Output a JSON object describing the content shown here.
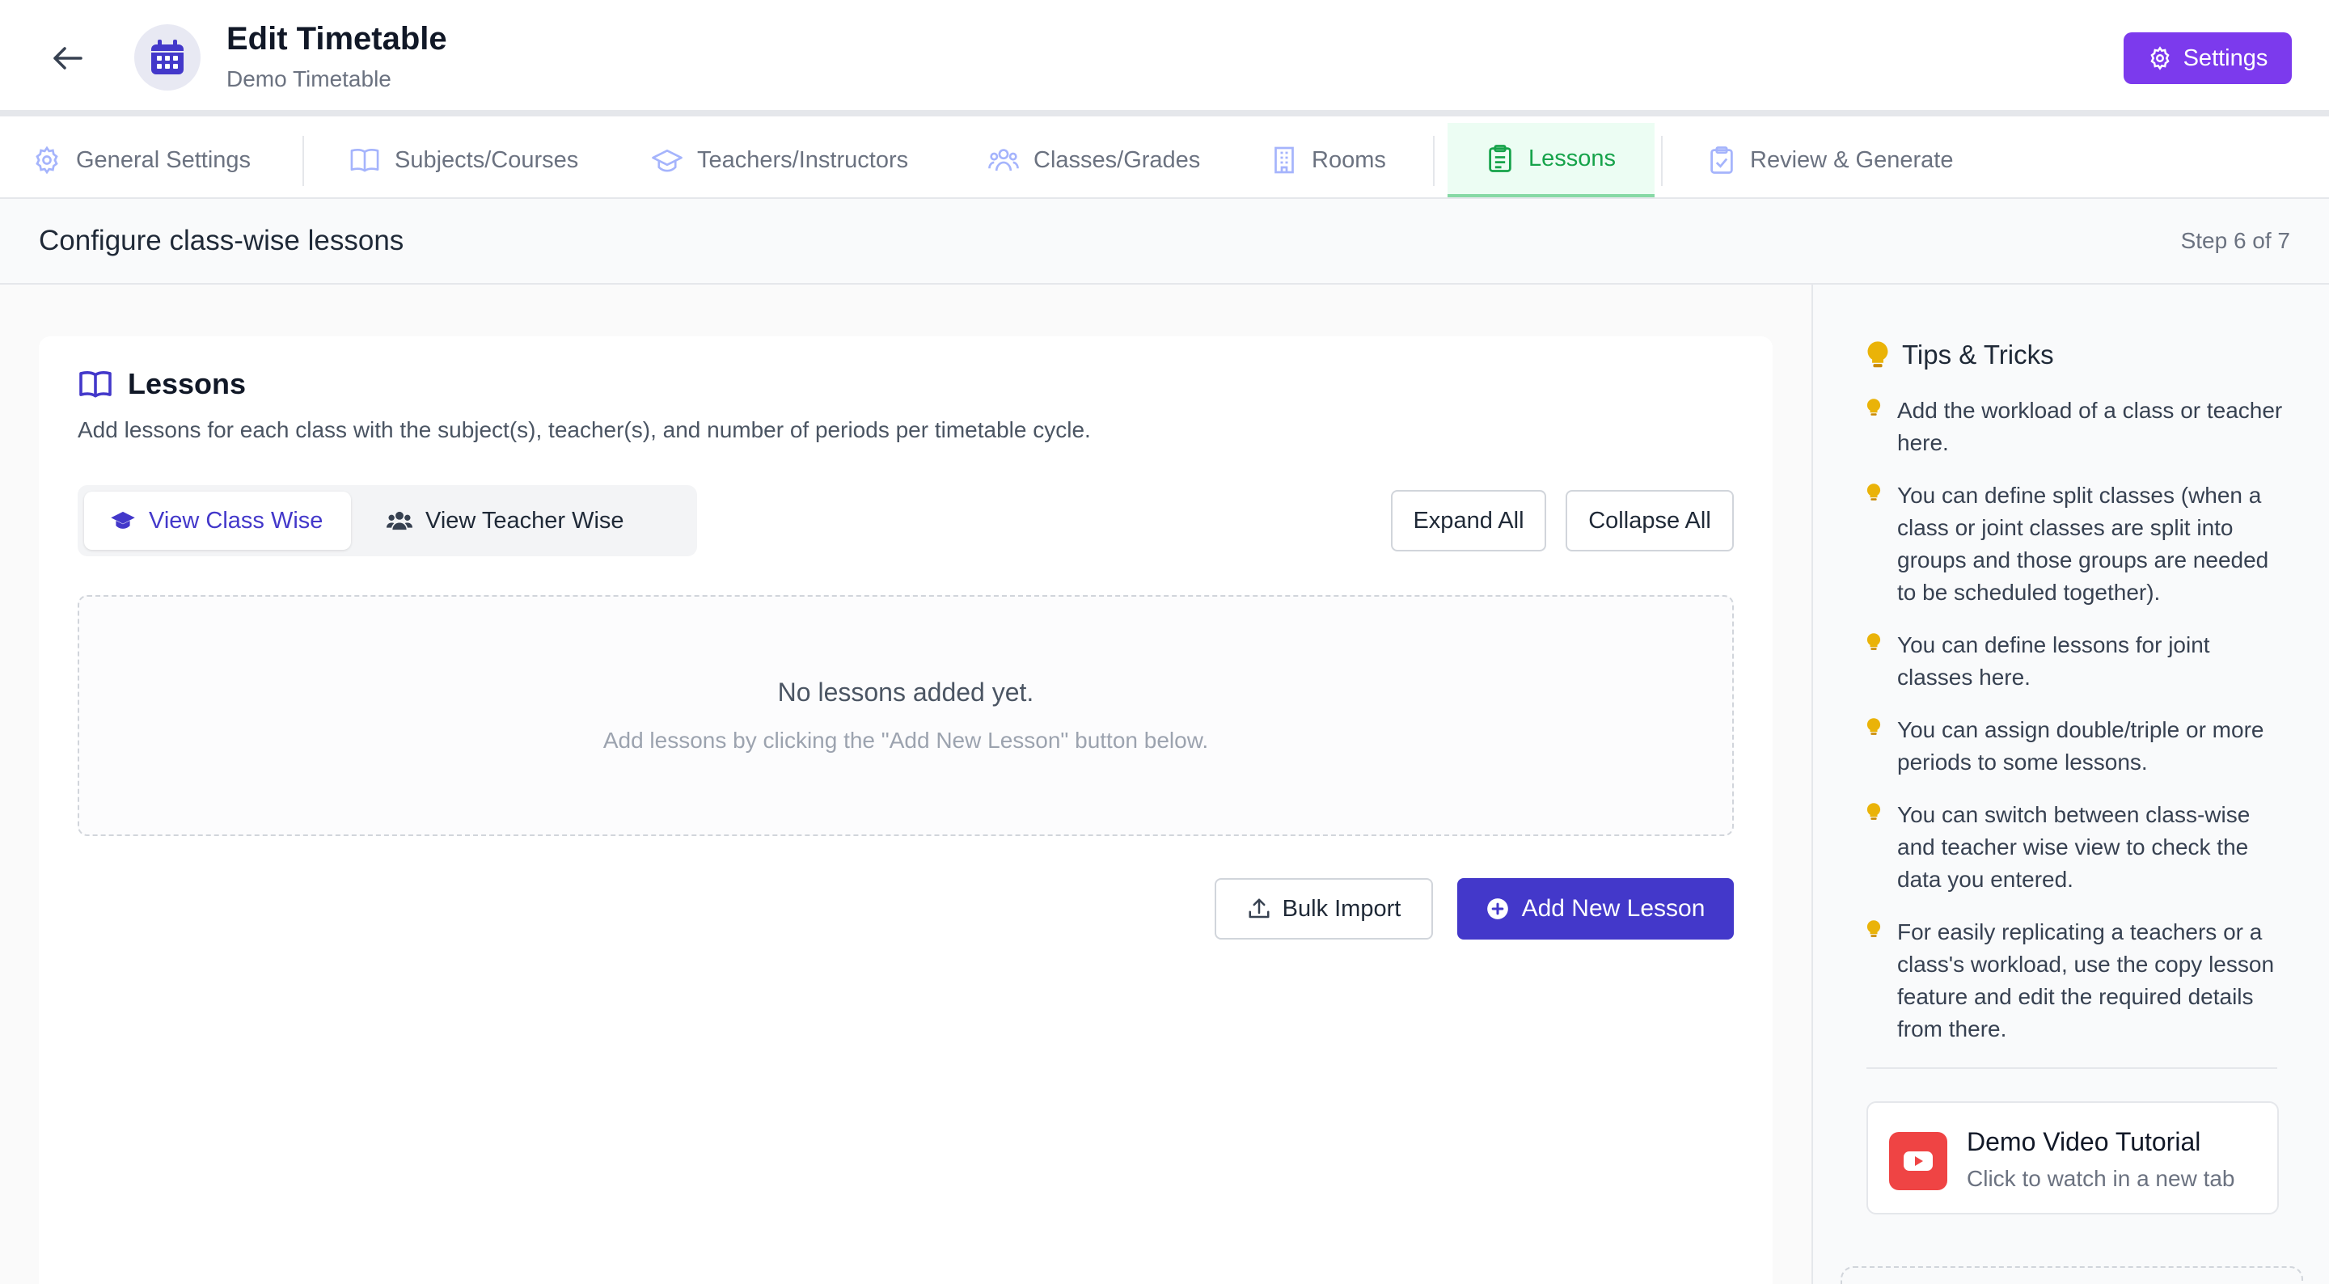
{
  "header": {
    "title": "Edit Timetable",
    "subtitle": "Demo Timetable",
    "settings_label": "Settings"
  },
  "tabs": [
    {
      "label": "General Settings",
      "icon": "gear-icon"
    },
    {
      "label": "Subjects/Courses",
      "icon": "book-icon"
    },
    {
      "label": "Teachers/Instructors",
      "icon": "graduation-cap-icon"
    },
    {
      "label": "Classes/Grades",
      "icon": "users-icon"
    },
    {
      "label": "Rooms",
      "icon": "building-icon"
    },
    {
      "label": "Lessons",
      "icon": "clipboard-icon",
      "active": true
    },
    {
      "label": "Review & Generate",
      "icon": "clipboard-check-icon"
    }
  ],
  "step": {
    "title": "Configure class-wise lessons",
    "counter": "Step 6 of 7"
  },
  "lessons": {
    "title": "Lessons",
    "description": "Add lessons for each class with the subject(s), teacher(s), and number of periods per timetable cycle.",
    "view_class_wise": "View Class Wise",
    "view_teacher_wise": "View Teacher Wise",
    "expand_all": "Expand All",
    "collapse_all": "Collapse All",
    "empty_title": "No lessons added yet.",
    "empty_subtitle": "Add lessons by clicking the \"Add New Lesson\" button below.",
    "bulk_import": "Bulk Import",
    "add_new_lesson": "Add New Lesson"
  },
  "tips": {
    "title": "Tips & Tricks",
    "items": [
      "Add the workload of a class or teacher here.",
      "You can define split classes (when a class or joint classes are split into groups and those groups are needed to be scheduled together).",
      "You can define lessons for joint classes here.",
      "You can assign double/triple or more periods to some lessons.",
      "You can switch between class-wise and teacher wise view to check the data you entered.",
      "For easily replicating a teachers or a class's workload, use the copy lesson feature and edit the required details from there."
    ]
  },
  "video": {
    "title": "Demo Video Tutorial",
    "subtitle": "Click to watch in a new tab"
  },
  "colors": {
    "primary": "#4338ca",
    "settings": "#7c3aed",
    "active_tab": "#16a34a",
    "tip_bulb": "#eab308",
    "youtube": "#ef4444"
  }
}
